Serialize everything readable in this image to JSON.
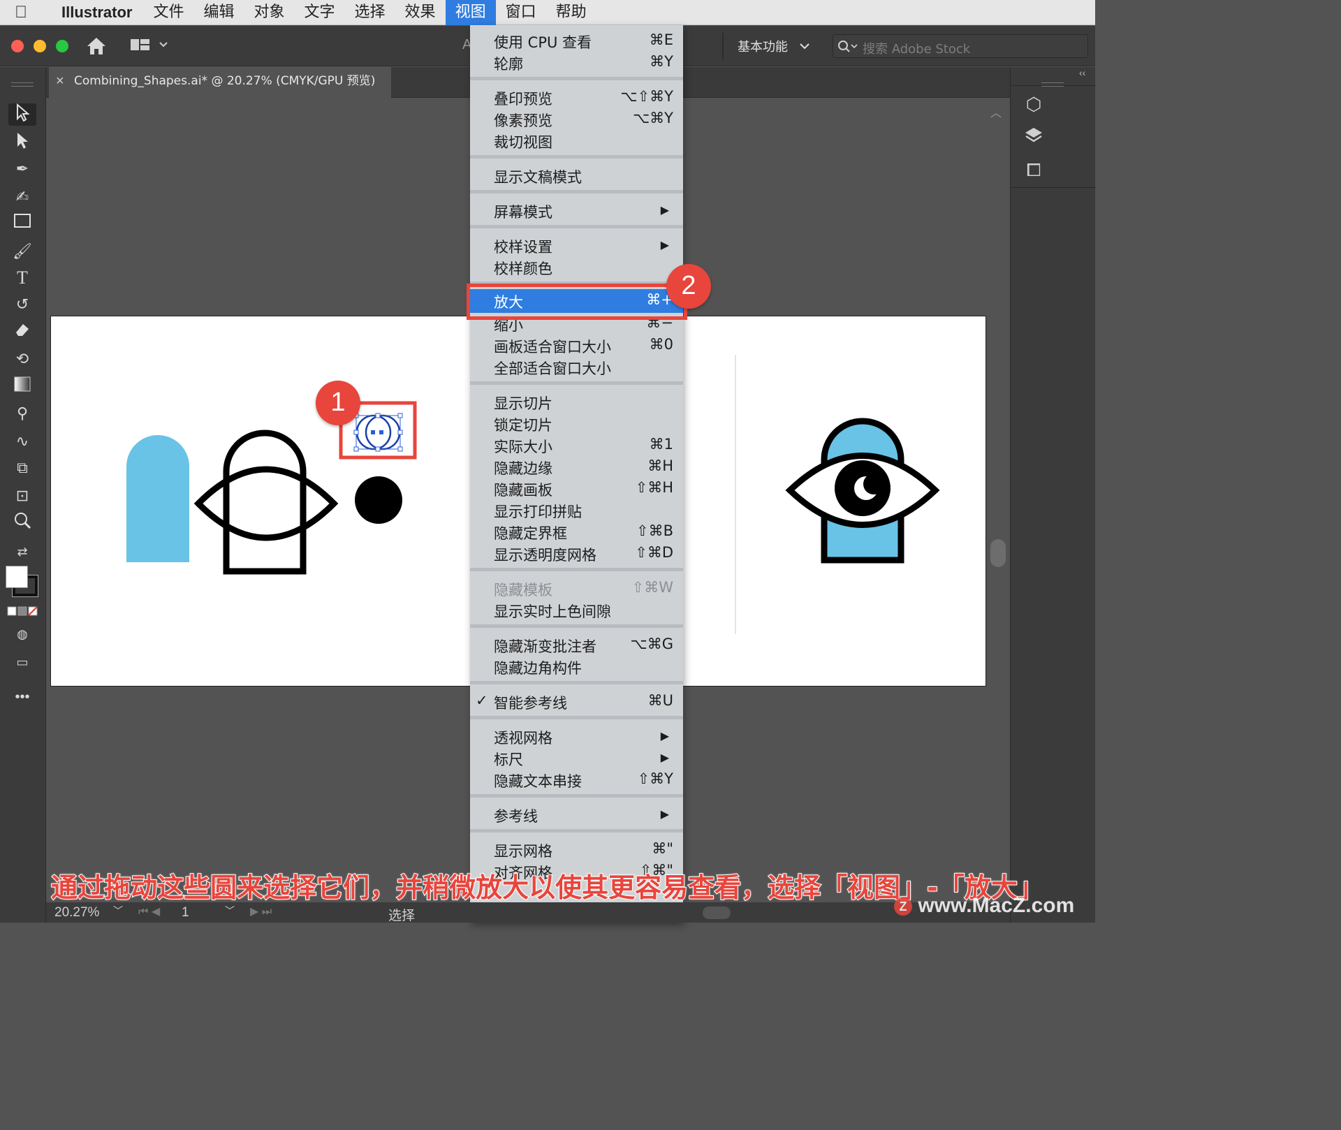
{
  "menubar": {
    "app_name": "Illustrator",
    "items": [
      "文件",
      "编辑",
      "对象",
      "文字",
      "选择",
      "效果",
      "视图",
      "窗口",
      "帮助"
    ],
    "active_index": 6
  },
  "controlbar": {
    "workspace": "基本功能",
    "search_placeholder": "搜索 Adobe Stock",
    "partial_text": "A"
  },
  "document_tab": {
    "title": "Combining_Shapes.ai* @ 20.27% (CMYK/GPU 预览)",
    "close": "×"
  },
  "view_menu": [
    {
      "label": "使用 CPU 查看",
      "shortcut": "⌘E"
    },
    {
      "label": "轮廓",
      "shortcut": "⌘Y"
    },
    {
      "sep": true
    },
    {
      "label": "叠印预览",
      "shortcut": "⌥⇧⌘Y"
    },
    {
      "label": "像素预览",
      "shortcut": "⌥⌘Y"
    },
    {
      "label": "裁切视图",
      "shortcut": ""
    },
    {
      "sep": true
    },
    {
      "label": "显示文稿模式",
      "shortcut": ""
    },
    {
      "sep": true
    },
    {
      "label": "屏幕模式",
      "shortcut": "▶"
    },
    {
      "sep": true
    },
    {
      "label": "校样设置",
      "shortcut": "▶"
    },
    {
      "label": "校样颜色",
      "shortcut": ""
    },
    {
      "sep": true
    },
    {
      "label": "放大",
      "shortcut": "⌘+",
      "highlighted": true
    },
    {
      "label": "缩小",
      "shortcut": "⌘−"
    },
    {
      "label": "画板适合窗口大小",
      "shortcut": "⌘0"
    },
    {
      "label": "全部适合窗口大小",
      "shortcut": ""
    },
    {
      "sep": true
    },
    {
      "label": "显示切片",
      "shortcut": ""
    },
    {
      "label": "锁定切片",
      "shortcut": ""
    },
    {
      "label": "实际大小",
      "shortcut": "⌘1"
    },
    {
      "label": "隐藏边缘",
      "shortcut": "⌘H"
    },
    {
      "label": "隐藏画板",
      "shortcut": "⇧⌘H"
    },
    {
      "label": "显示打印拼贴",
      "shortcut": ""
    },
    {
      "label": "隐藏定界框",
      "shortcut": "⇧⌘B"
    },
    {
      "label": "显示透明度网格",
      "shortcut": "⇧⌘D"
    },
    {
      "sep": true
    },
    {
      "label": "隐藏模板",
      "shortcut": "⇧⌘W",
      "disabled": true
    },
    {
      "label": "显示实时上色间隙",
      "shortcut": ""
    },
    {
      "sep": true
    },
    {
      "label": "隐藏渐变批注者",
      "shortcut": "⌥⌘G"
    },
    {
      "label": "隐藏边角构件",
      "shortcut": ""
    },
    {
      "sep": true
    },
    {
      "label": "智能参考线",
      "shortcut": "⌘U",
      "checked": true
    },
    {
      "sep": true
    },
    {
      "label": "透视网格",
      "shortcut": "▶"
    },
    {
      "label": "标尺",
      "shortcut": "▶"
    },
    {
      "label": "隐藏文本串接",
      "shortcut": "⇧⌘Y"
    },
    {
      "sep": true
    },
    {
      "label": "参考线",
      "shortcut": "▶"
    },
    {
      "sep": true
    },
    {
      "label": "显示网格",
      "shortcut": "⌘\""
    },
    {
      "label": "对齐网格",
      "shortcut": "⇧⌘\""
    }
  ],
  "menu_more_arrow": "▼",
  "callouts": {
    "one": "1",
    "two": "2"
  },
  "caption": "通过拖动这些圆来选择它们，并稍微放大以使其更容易查看，选择「视图」-「放大」",
  "statusbar": {
    "zoom": "20.27%",
    "page": "1",
    "tool": "选择"
  },
  "watermark": "www.MacZ.com",
  "colors": {
    "accent": "#2f7de1",
    "callout": "#e8453c",
    "shape_blue": "#68c3e6"
  }
}
